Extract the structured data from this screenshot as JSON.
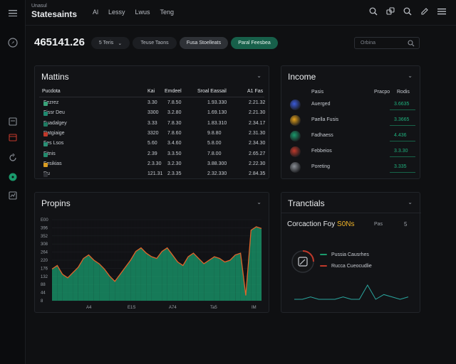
{
  "rail": {
    "icons": [
      "menu-icon",
      "compass-icon",
      "document-icon",
      "calendar-icon",
      "refresh-icon",
      "active-dot-icon",
      "chart-icon"
    ]
  },
  "topbar": {
    "brand_small": "Unasul",
    "brand": "Statesaints",
    "nav": [
      "Al",
      "Lessy",
      "Lwus",
      "Teng"
    ],
    "icons": [
      "search-icon",
      "link-icon",
      "search-icon",
      "edit-icon",
      "menu-icon"
    ]
  },
  "summary": {
    "balance": "465141.26",
    "pills": [
      "5 Teris",
      "Teuse Taons",
      "Fusa Stoelleats",
      "Paral Feesbea"
    ],
    "search_placeholder": "Orbina"
  },
  "matrix": {
    "title": "Mattins",
    "headers": [
      "Pucdota",
      "Kai",
      "Emdeel",
      "Sroal Eassail",
      "A1 Fas"
    ],
    "rows": [
      {
        "name": "Fezrez",
        "color": "#3aa37a",
        "c1": "3.30",
        "c2": "7.8.50",
        "c3": "1.93.330",
        "c4": "2.21.32"
      },
      {
        "name": "Fissr Deu",
        "color": "#1f8a70",
        "c1": "3300",
        "c2": "3.2.80",
        "c3": "1.69.130",
        "c4": "2.21.30"
      },
      {
        "name": "Fuadalgey",
        "color": "#1e7a62",
        "c1": "3.33",
        "c2": "7.8.30",
        "c3": "1.83.310",
        "c4": "2.34.17"
      },
      {
        "name": "Ratgiaige",
        "color": "#c0392b",
        "c1": "3320",
        "c2": "7.8.60",
        "c3": "9.8.80",
        "c4": "2.31.30"
      },
      {
        "name": "Fes Lsos",
        "color": "#2a8f76",
        "c1": "5.60",
        "c2": "3.4.60",
        "c3": "5.8.00",
        "c4": "2.34.30"
      },
      {
        "name": "Fitnis",
        "color": "#228a6d",
        "c1": "2.39",
        "c2": "3.3.50",
        "c3": "7.8.00",
        "c4": "2.65.27"
      },
      {
        "name": "Fesikias",
        "color": "#d99c22",
        "c1": "2.3.30",
        "c2": "3.2.30",
        "c3": "3.88.300",
        "c4": "2.22.30"
      },
      {
        "name": "Du",
        "color": "#2e3035",
        "c1": "121.31",
        "c2": "2.3.35",
        "c3": "2.32.330",
        "c4": "2.84.35"
      }
    ]
  },
  "income": {
    "title": "Income",
    "headers": [
      "Pasis",
      "Pracpo",
      "Rodis"
    ],
    "items": [
      {
        "name": "Auerged",
        "value": "3.6635"
      },
      {
        "name": "Paella Fusis",
        "value": "3.3665"
      },
      {
        "name": "Fadhaess",
        "value": "4.436"
      },
      {
        "name": "Febbeios",
        "value": "3.3.30"
      },
      {
        "name": "Poreting",
        "value": "3.335"
      }
    ]
  },
  "programs": {
    "title": "Propins"
  },
  "chart_data": {
    "type": "area",
    "title": "Propins",
    "x": [
      "A4",
      "E1S",
      "A74",
      "Ta5",
      "IM"
    ],
    "y_ticks": [
      "8",
      "44",
      "88",
      "132",
      "176",
      "220",
      "264",
      "308",
      "352",
      "396",
      "E00"
    ],
    "ylim": [
      0,
      460
    ],
    "series": [
      {
        "color": "#1a9a6c",
        "values": [
          180,
          200,
          150,
          130,
          160,
          190,
          240,
          260,
          230,
          210,
          180,
          140,
          110,
          150,
          190,
          230,
          280,
          300,
          270,
          250,
          240,
          280,
          300,
          260,
          220,
          200,
          250,
          270,
          240,
          210,
          230,
          250,
          240,
          220,
          230,
          260,
          270,
          30,
          400,
          420,
          410
        ]
      }
    ],
    "grid": true
  },
  "trends": {
    "title": "Tranctials",
    "subtitle_prefix": "Corcaction Foy",
    "subtitle_accent": "S0Ns",
    "tag": "Pas",
    "tag_value": "5",
    "legend": [
      {
        "label": "Pussia Causrhes",
        "color": "#1a9a6c"
      },
      {
        "label": "Rucca Cueocudlie",
        "color": "#c0392b"
      }
    ],
    "sparkline": [
      0,
      0,
      1,
      0,
      0,
      0,
      1,
      0,
      0,
      6,
      0,
      2,
      1,
      0,
      1
    ]
  }
}
